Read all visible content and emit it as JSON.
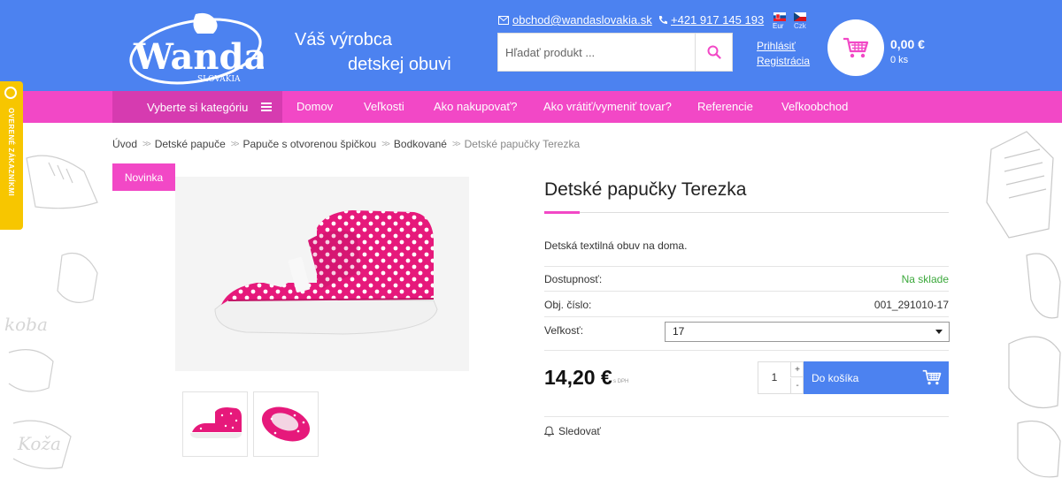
{
  "header": {
    "logo_text": "Wanda",
    "logo_sub": "SLOVAKIA",
    "slogan_line1": "Váš výrobca",
    "slogan_line2": "detskej obuvi",
    "email": "obchod@wandaslovakia.sk",
    "phone": "+421 917 145 193",
    "flags": [
      {
        "label": "Eur",
        "icon": "slovak-flag-icon"
      },
      {
        "label": "Czk",
        "icon": "czech-flag-icon"
      }
    ],
    "search_placeholder": "Hľadať produkt ...",
    "login": "Prihlásiť",
    "register": "Registrácia",
    "cart_price": "0,00 €",
    "cart_count": "0 ks",
    "colors": {
      "header": "#4c82f0",
      "accent": "#f248c6"
    }
  },
  "nav": {
    "category_label": "Vyberte si kategóriu",
    "items": [
      "Domov",
      "Veľkosti",
      "Ako nakupovať?",
      "Ako vrátiť/vymeniť tovar?",
      "Referencie",
      "Veľkoobchod"
    ]
  },
  "verified_badge": "OVERENÉ ZÁKAZNÍKMI",
  "breadcrumb": [
    "Úvod",
    "Detské papuče",
    "Papuče s otvorenou špičkou",
    "Bodkované",
    "Detské papučky Terezka"
  ],
  "product": {
    "badge": "Novinka",
    "title": "Detské papučky Terezka",
    "description": "Detská textilná obuv na doma.",
    "availability_label": "Dostupnosť:",
    "availability_value": "Na sklade",
    "code_label": "Obj. číslo:",
    "code_value": "001_291010-17",
    "size_label": "Veľkosť:",
    "size_value": "17",
    "price": "14,20 €",
    "price_note": "s DPH",
    "quantity": "1",
    "qty_plus": "+",
    "qty_minus": "-",
    "add_to_cart": "Do košíka",
    "watch": "Sledovať"
  }
}
